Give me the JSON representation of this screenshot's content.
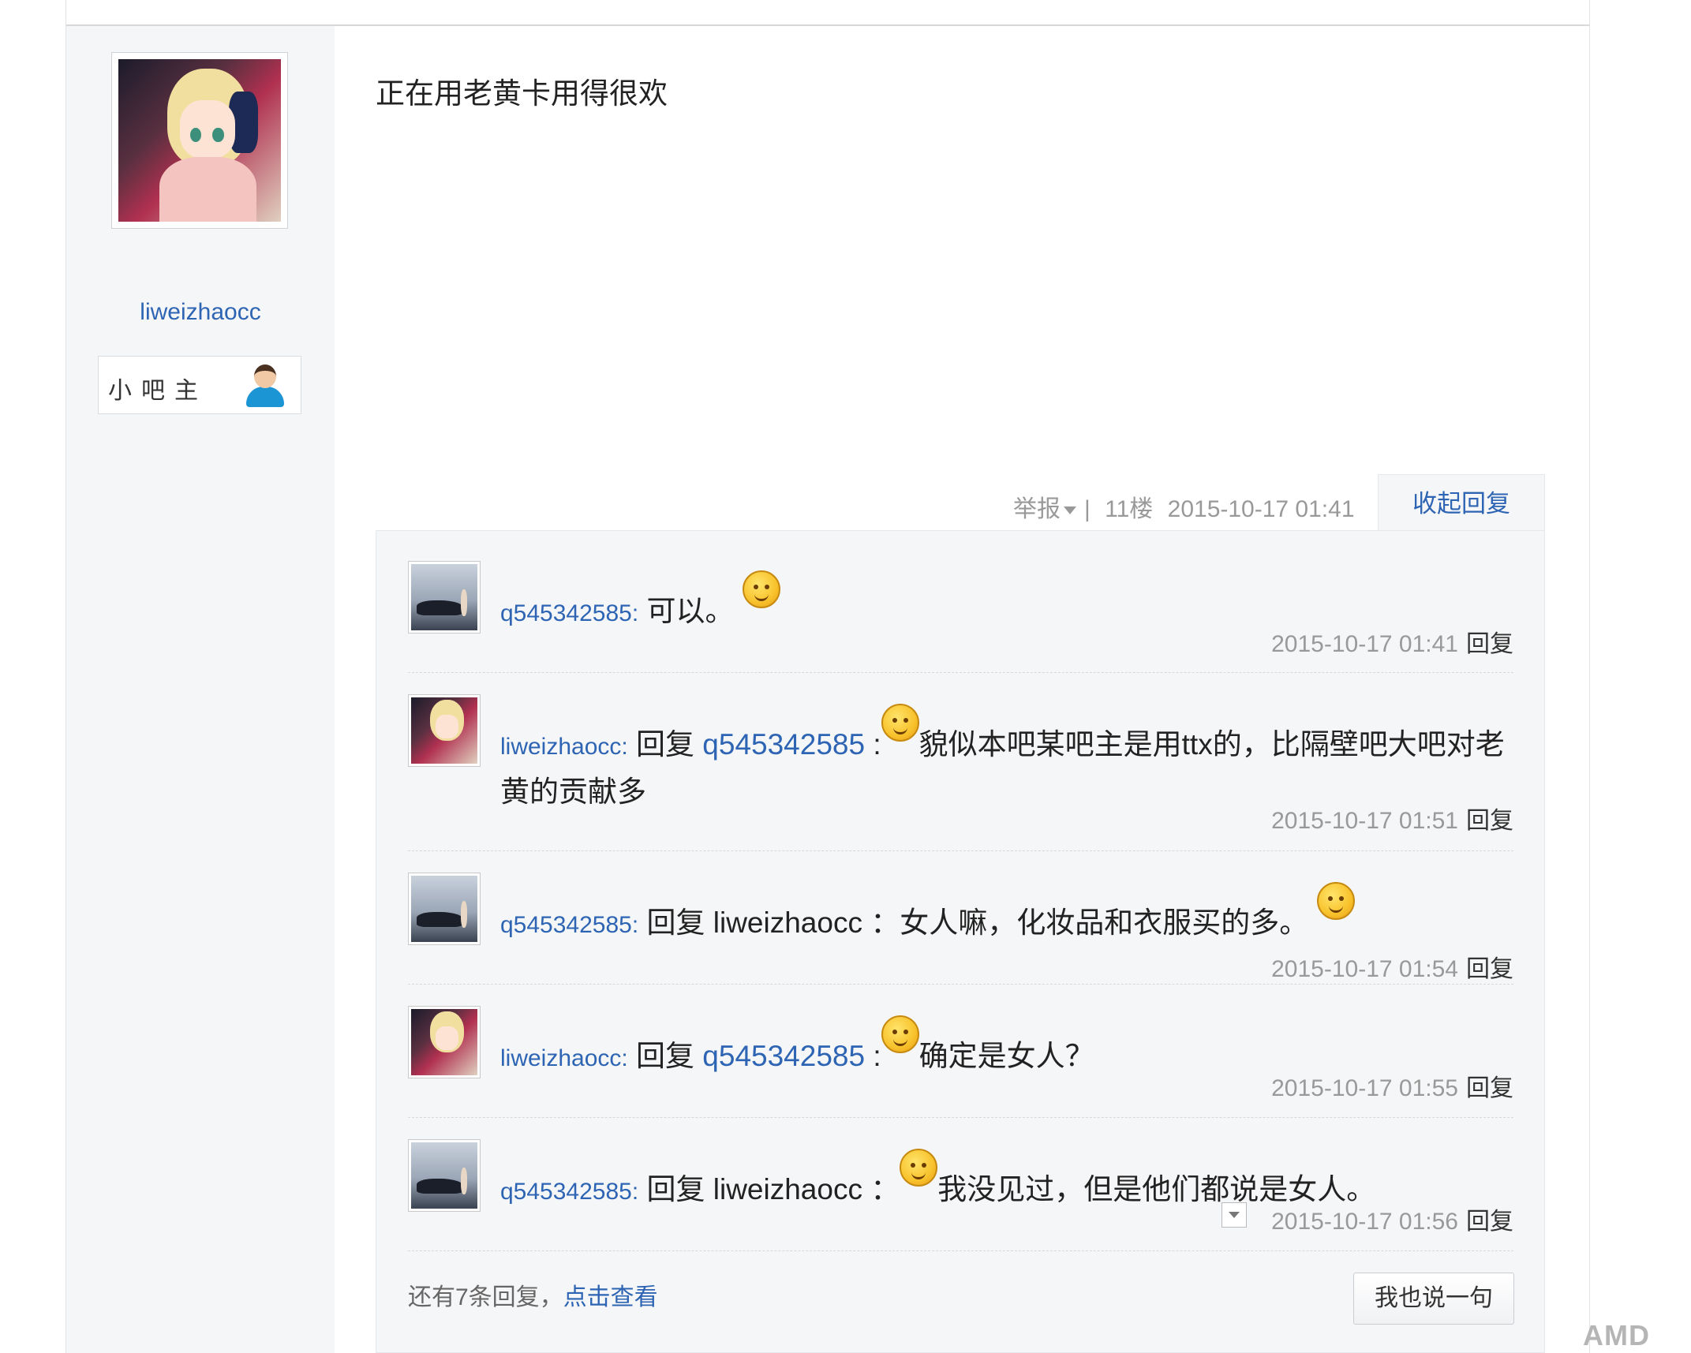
{
  "post": {
    "author": {
      "name": "liweizhaocc",
      "role": "小吧主",
      "avatar_icon": "anime-girl-avatar",
      "role_icon": "person-icon"
    },
    "content": "正在用老黄卡用得很欢",
    "meta": {
      "report_label": "举报",
      "separator": "|",
      "floor": "11楼",
      "time": "2015-10-17 01:41",
      "collapse_label": "收起回复"
    }
  },
  "replies": [
    {
      "user": "q545342585:",
      "parts": {
        "text": "可以。"
      },
      "emoji": "angry-emoji",
      "time": "2015-10-17 01:41",
      "reply_label": "回复"
    },
    {
      "user": "liweizhaocc:",
      "parts": {
        "prefix": "回复",
        "target": "q545342585",
        "colon": ":",
        "text": "貌似本吧某吧主是用ttx的，比隔壁吧大吧对老黄的贡献多"
      },
      "emoji": "smile-emoji",
      "time": "2015-10-17 01:51",
      "reply_label": "回复"
    },
    {
      "user": "q545342585:",
      "parts": {
        "prefix": "回复 liweizhaocc ：",
        "text": "女人嘛，化妆品和衣服买的多。"
      },
      "emoji": "shy-emoji",
      "time": "2015-10-17 01:54",
      "reply_label": "回复"
    },
    {
      "user": "liweizhaocc:",
      "parts": {
        "prefix": "回复",
        "target": "q545342585",
        "colon": ":",
        "text": "确定是女人？"
      },
      "emoji": "smile-emoji",
      "time": "2015-10-17 01:55",
      "reply_label": "回复"
    },
    {
      "user": "q545342585:",
      "parts": {
        "prefix": "回复 liweizhaocc ：",
        "text": "我没见过，但是他们都说是女人。"
      },
      "emoji": "sleepy-emoji",
      "time": "2015-10-17 01:56",
      "reply_label": "回复"
    }
  ],
  "footer": {
    "more_text": "还有7条回复，",
    "more_link": "点击查看",
    "say_button": "我也说一句"
  },
  "watermark": "AMD"
}
